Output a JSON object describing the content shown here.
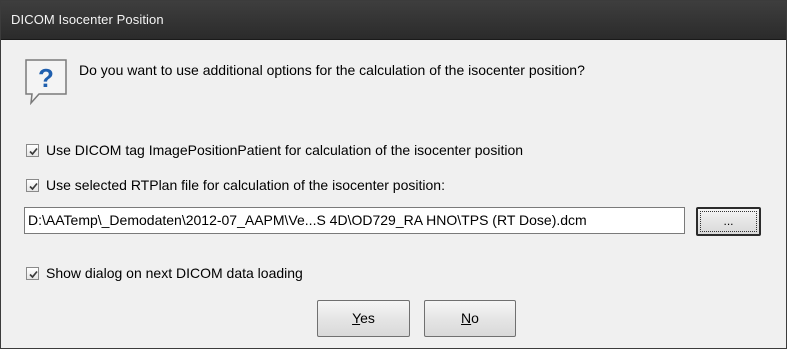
{
  "window": {
    "title": "DICOM Isocenter Position"
  },
  "message": {
    "icon": "question-icon",
    "text": "Do you want to use additional options for the calculation of the isocenter position?"
  },
  "options": [
    {
      "label": "Use DICOM tag ImagePositionPatient for calculation of the isocenter position",
      "checked": true
    },
    {
      "label": "Use selected RTPlan file for calculation of the isocenter position:",
      "checked": true
    }
  ],
  "file_path": {
    "value": "D:\\AATemp\\_Demodaten\\2012-07_AAPM\\Ve...S 4D\\OD729_RA HNO\\TPS (RT Dose).dcm",
    "browse_label": "..."
  },
  "show_dialog": {
    "label": "Show dialog on next DICOM data loading",
    "checked": true
  },
  "buttons": {
    "yes_mnemonic": "Y",
    "yes_rest": "es",
    "no_mnemonic": "N",
    "no_rest": "o"
  },
  "colors": {
    "titlebar": "#2f2f2f",
    "background": "#f0f0f0",
    "icon_blue": "#1f5fae"
  }
}
